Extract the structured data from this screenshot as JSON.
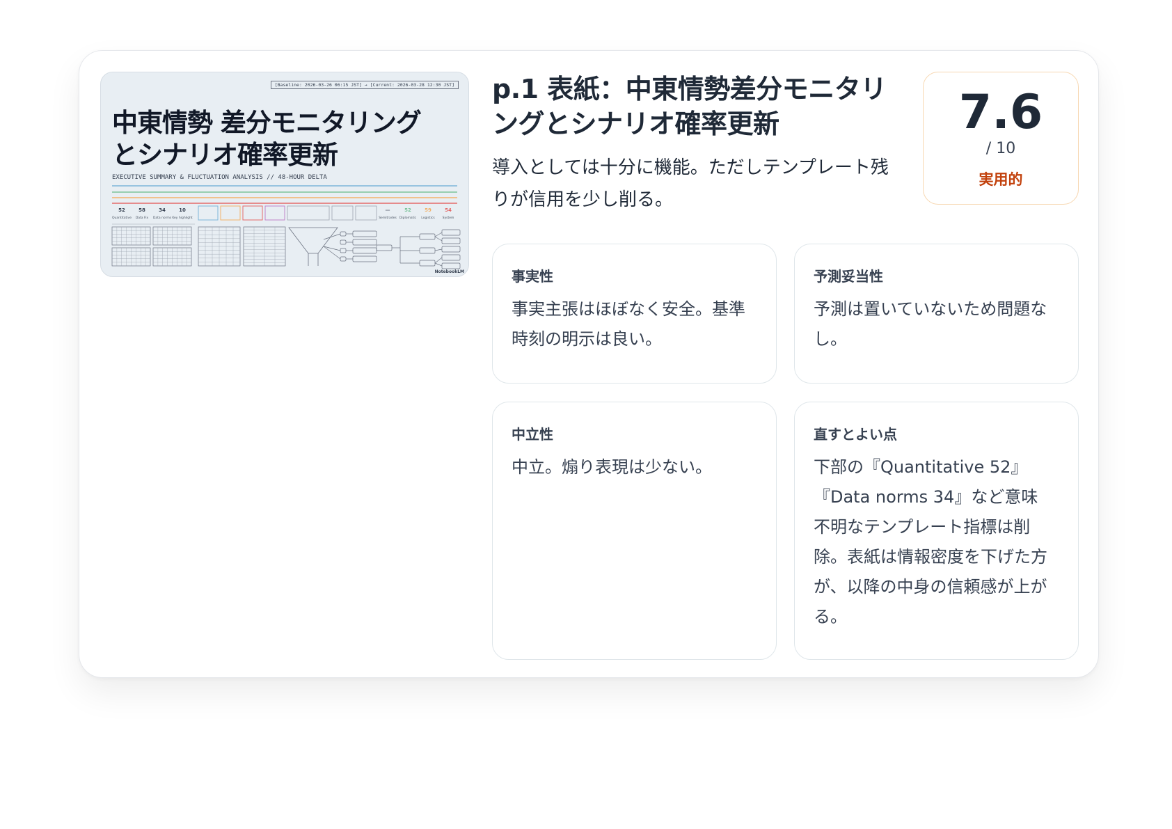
{
  "slide": {
    "stamp": "[Baseline: 2026-03-26 06:15 JST] → [Current: 2026-03-28 12:30 JST]",
    "title": "中東情勢 差分モニタリングとシナリオ確率更新",
    "subtitle": "EXECUTIVE SUMMARY & FLUCTUATION ANALYSIS // 48-HOUR DELTA",
    "stats": [
      {
        "value": "52",
        "label": "Quantitative"
      },
      {
        "value": "58",
        "label": "Data Fix"
      },
      {
        "value": "34",
        "label": "Data norms"
      },
      {
        "value": "10",
        "label": "Key highlight"
      }
    ],
    "right_stats": [
      {
        "value": "—",
        "label": "Semitrades"
      },
      {
        "value": "52",
        "label": "Diplomatic Resolution"
      },
      {
        "value": "59",
        "label": "Logistics Paralysis"
      },
      {
        "value": "54",
        "label": "System Crisis"
      }
    ],
    "logo": "NotebookLM",
    "colors": {
      "line_blue": "#7eb6d9",
      "line_orange": "#f2b26b",
      "line_red": "#e46a6a",
      "line_green": "#7cc49a"
    }
  },
  "header": {
    "title": "p.1 表紙：中東情勢差分モニタリングとシナリオ確率更新",
    "summary": "導入としては十分に機能。ただしテンプレート残りが信用を少し削る。"
  },
  "score": {
    "value": "7.6",
    "max": "/ 10",
    "label": "実用的",
    "accent_color": "#c2410c"
  },
  "criteria": [
    {
      "heading": "事実性",
      "body": "事実主張はほぼなく安全。基準時刻の明示は良い。"
    },
    {
      "heading": "予測妥当性",
      "body": "予測は置いていないため問題なし。"
    },
    {
      "heading": "中立性",
      "body": "中立。煽り表現は少ない。"
    },
    {
      "heading": "直すとよい点",
      "body": "下部の『Quantitative 52』『Data norms 34』など意味不明なテンプレート指標は削除。表紙は情報密度を下げた方が、以降の中身の信頼感が上がる。"
    }
  ]
}
